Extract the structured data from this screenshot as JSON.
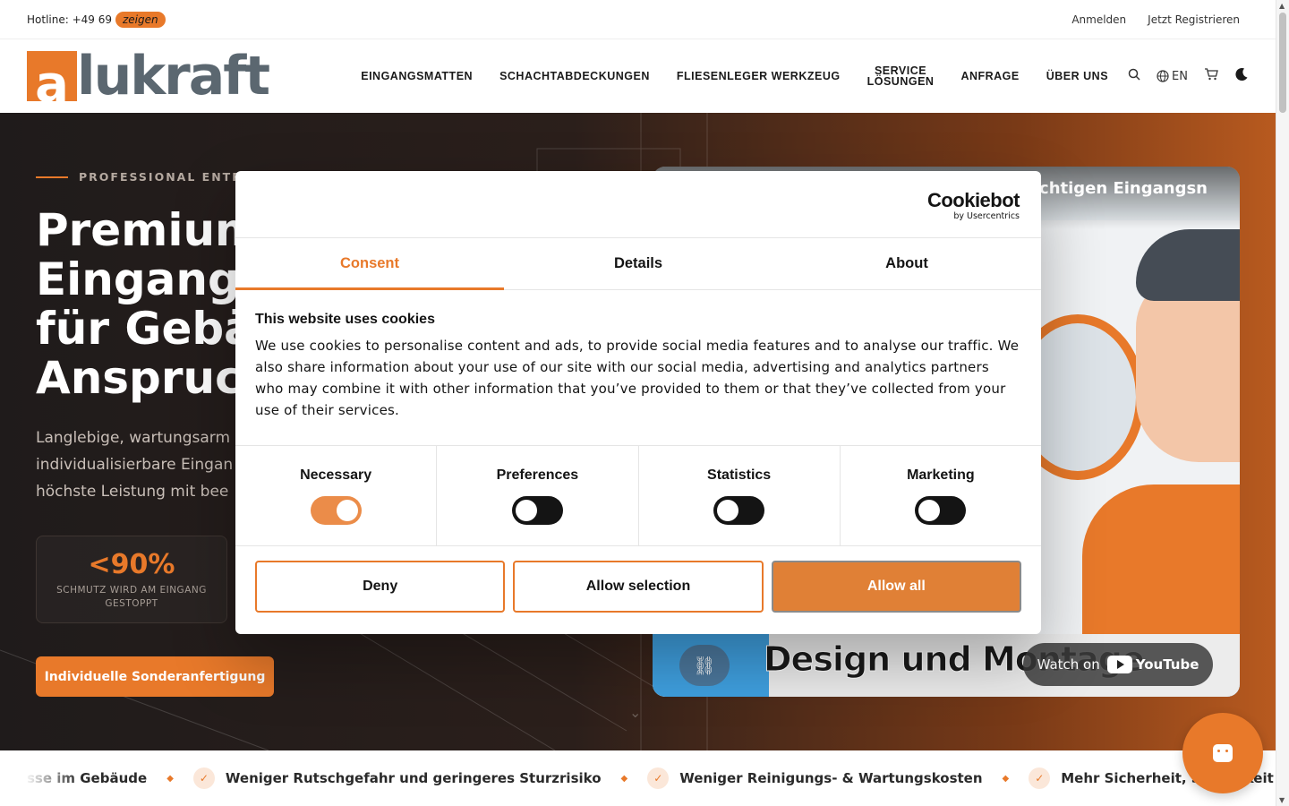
{
  "topbar": {
    "hotline_label": "Hotline: +49 69",
    "hotline_reveal": "zeigen",
    "login": "Anmelden",
    "register": "Jetzt Registrieren"
  },
  "header": {
    "logo_a": "a",
    "logo_text": "lukraft",
    "nav": [
      "EINGANGSMATTEN",
      "SCHACHTABDECKUNGEN",
      "FLIESENLEGER WERKZEUG",
      "SERVICE",
      "LÖSUNGEN",
      "ANFRAGE",
      "ÜBER UNS"
    ],
    "language": "EN"
  },
  "hero": {
    "kicker": "PROFESSIONAL ENTRANC",
    "title_lines": [
      "Premium",
      "Eingangs",
      "für Gebäu",
      "Anspruch"
    ],
    "subtitle_lines": [
      "Langlebige, wartungsarm",
      "individualisierbare Eingan",
      "höchste Leistung mit bee"
    ],
    "stat_value": "<90%",
    "stat_label_1": "SCHMUTZ WIRD AM EINGANG",
    "stat_label_2": "GESTOPPT",
    "cta": "Individuelle Sonderanfertigung"
  },
  "video": {
    "title": "r richtigen Eingangsn",
    "overlay_text": "Design und Montage",
    "watch_on": "Watch on",
    "youtube": "YouTube"
  },
  "marquee": {
    "items": [
      "sse im Gebäude",
      "Weniger Rutschgefahr und geringeres Sturzrisiko",
      "Weniger Reinigungs- & Wartungskosten",
      "Mehr Sicherheit, Sauberkeit und Fu"
    ]
  },
  "cookie": {
    "brand": "Cookiebot",
    "brand_sub": "by Usercentrics",
    "tabs": [
      "Consent",
      "Details",
      "About"
    ],
    "heading": "This website uses cookies",
    "text": "We use cookies to personalise content and ads, to provide social media features and to analyse our traffic. We also share information about your use of our site with our social media, advertising and analytics partners who may combine it with other information that you’ve provided to them or that they’ve collected from your use of their services.",
    "toggles": [
      {
        "label": "Necessary",
        "on": true
      },
      {
        "label": "Preferences",
        "on": false
      },
      {
        "label": "Statistics",
        "on": false
      },
      {
        "label": "Marketing",
        "on": false
      }
    ],
    "buttons": {
      "deny": "Deny",
      "allow_selection": "Allow selection",
      "allow_all": "Allow all"
    }
  },
  "colors": {
    "accent": "#e8792a",
    "dark": "#1f1b1b",
    "logo_gray": "#5b6770"
  }
}
